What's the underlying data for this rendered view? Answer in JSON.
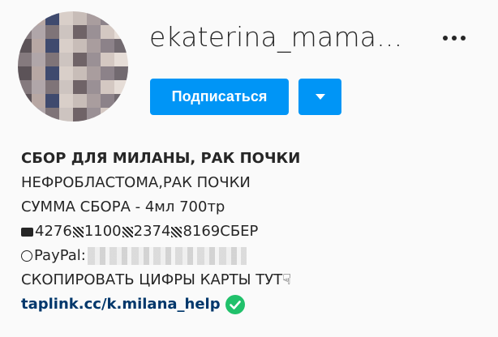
{
  "profile": {
    "username": "ekaterina_mama...",
    "follow_label": "Подписаться",
    "avatar_icon": "blurred-avatar",
    "more_icon": "more-options-icon",
    "dropdown_icon": "chevron-down-icon"
  },
  "bio": {
    "title": "СБОР ДЛЯ МИЛАНЫ, РАК ПОЧКИ",
    "line1": "НЕФРОБЛАСТОМА,РАК ПОЧКИ",
    "line2": "СУММА СБОРА - 4мл 700тр",
    "card": {
      "part1": "4276",
      "part2": "1100",
      "part3": "2374",
      "part4": "8169СБЕР"
    },
    "paypal_label": "PayPal:",
    "copy_text": "СКОПИРОВАТЬ ЦИФРЫ КАРТЫ ТУТ",
    "link": "taplink.cc/k.milana_help"
  },
  "colors": {
    "accent": "#0095f6",
    "link": "#00376b",
    "verified": "#21c16b",
    "text": "#262626"
  }
}
